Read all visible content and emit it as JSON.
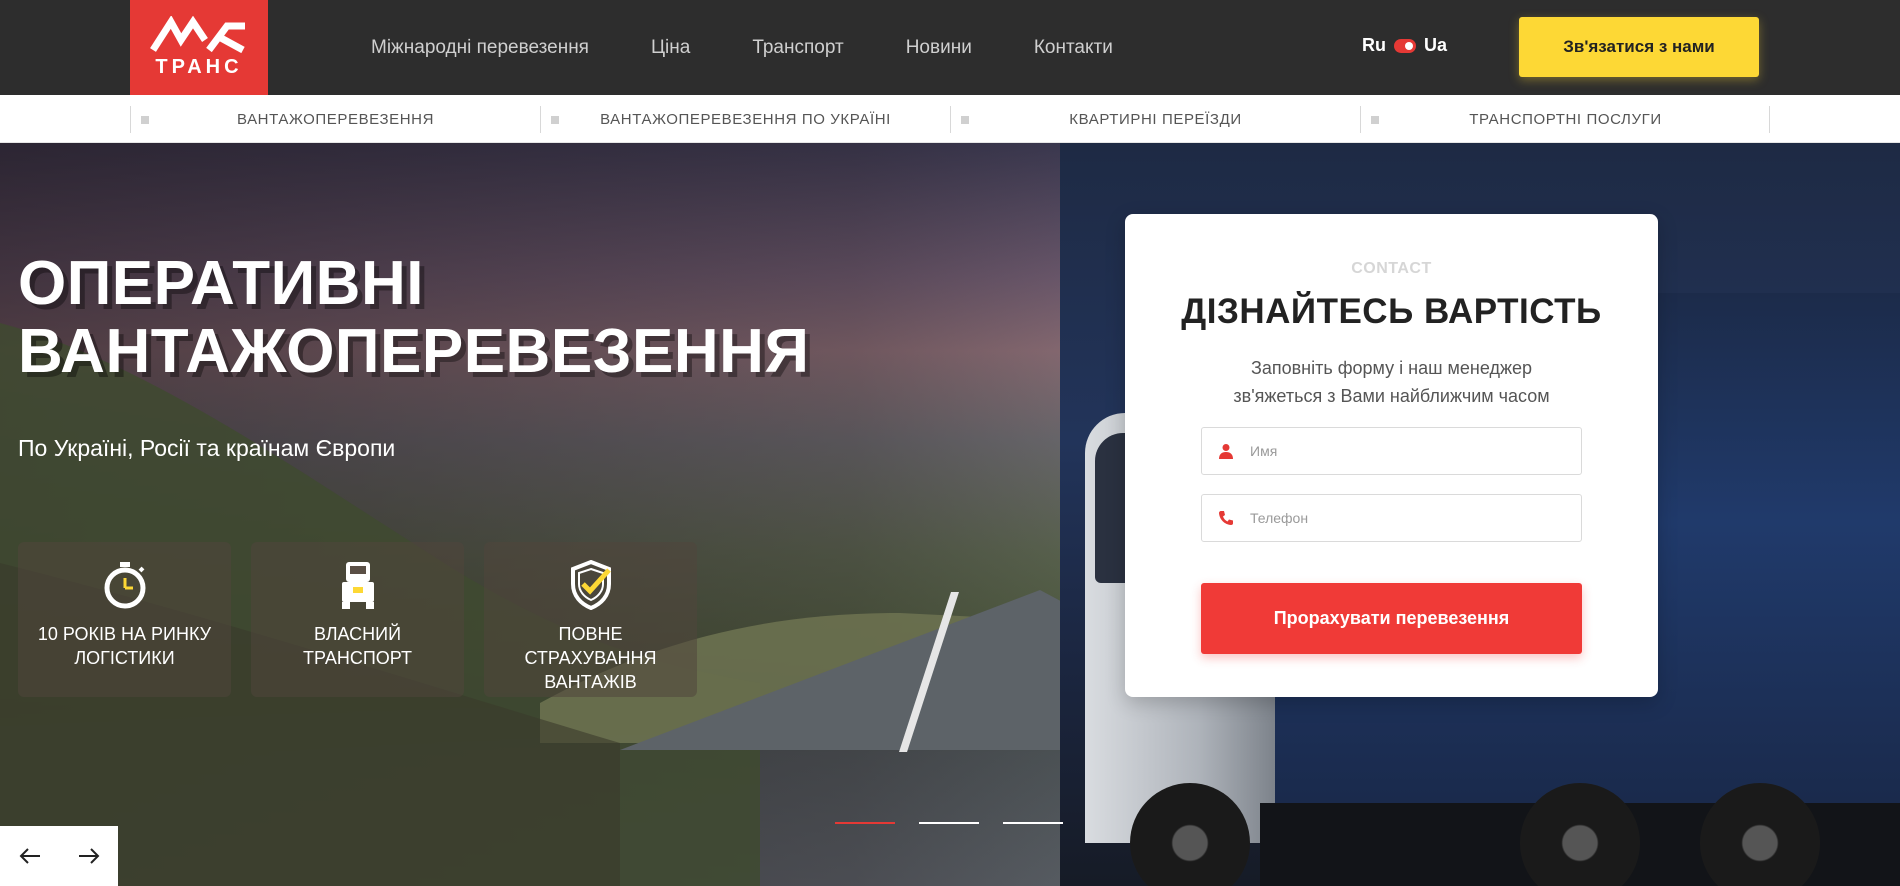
{
  "header": {
    "logo_text": "ТРАНС",
    "nav": [
      "Міжнародні перевезення",
      "Ціна",
      "Транспорт",
      "Новини",
      "Контакти"
    ],
    "lang": {
      "left": "Ru",
      "right": "Ua"
    },
    "contact_button": "Зв'язатися з нами"
  },
  "subnav": [
    "ВАНТАЖОПЕРЕВЕЗЕННЯ",
    "ВАНТАЖОПЕРЕВЕЗЕННЯ ПО УКРАЇНІ",
    "КВАРТИРНІ ПЕРЕЇЗДИ",
    "ТРАНСПОРТНІ ПОСЛУГИ"
  ],
  "hero": {
    "title_line1": "ОПЕРАТИВНІ",
    "title_line2": "ВАНТАЖОПЕРЕВЕЗЕННЯ",
    "subtitle": "По Україні, Росії та країнам Європи",
    "features": [
      {
        "icon": "stopwatch-icon",
        "line1": "10 РОКІВ НА РИНКУ",
        "line2": "ЛОГІСТИКИ"
      },
      {
        "icon": "truck-icon",
        "line1": "ВЛАСНИЙ",
        "line2": "ТРАНСПОРТ"
      },
      {
        "icon": "shield-check-icon",
        "line1": "ПОВНЕ СТРАХУВАННЯ",
        "line2": "ВАНТАЖІВ"
      }
    ]
  },
  "form": {
    "eyebrow": "CONTACT",
    "title": "ДІЗНАЙТЕСЬ ВАРТІСТЬ",
    "desc_line1": "Заповніть форму і наш менеджер",
    "desc_line2": "зв'яжеться з Вами найближчим часом",
    "name_placeholder": "Имя",
    "phone_placeholder": "Телефон",
    "submit": "Прорахувати перевезення"
  },
  "slider": {
    "active_slide": 1,
    "slide_count": 3
  },
  "colors": {
    "brand_red": "#e53935",
    "accent_yellow": "#fdd835",
    "button_red": "#f03a37"
  }
}
